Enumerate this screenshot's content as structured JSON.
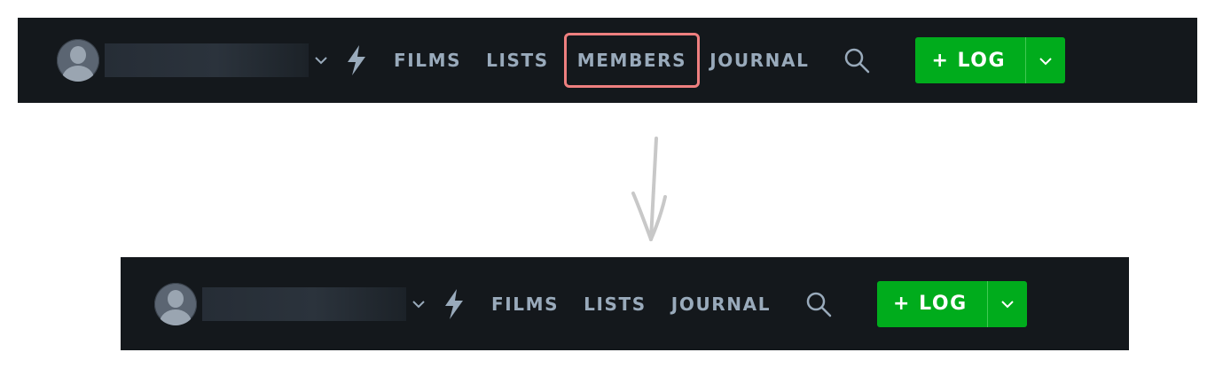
{
  "top_bar": {
    "username": "",
    "links": {
      "films": "FILMS",
      "lists": "LISTS",
      "members": "MEMBERS",
      "journal": "JOURNAL"
    },
    "log_label": "+ LOG"
  },
  "bottom_bar": {
    "username": "",
    "links": {
      "films": "FILMS",
      "lists": "LISTS",
      "journal": "JOURNAL"
    },
    "log_label": "+ LOG"
  },
  "icons": {
    "avatar": "avatar-icon",
    "caret": "chevron-down-icon",
    "activity": "lightning-bolt-icon",
    "search": "search-icon",
    "log_caret": "chevron-down-icon",
    "transition": "arrow-down-icon"
  },
  "colors": {
    "nav_background": "#14181c",
    "nav_text": "#99aabb",
    "log_button": "#00ac1c",
    "highlight": "#ee7f7f",
    "arrow": "#c8c8c8"
  }
}
